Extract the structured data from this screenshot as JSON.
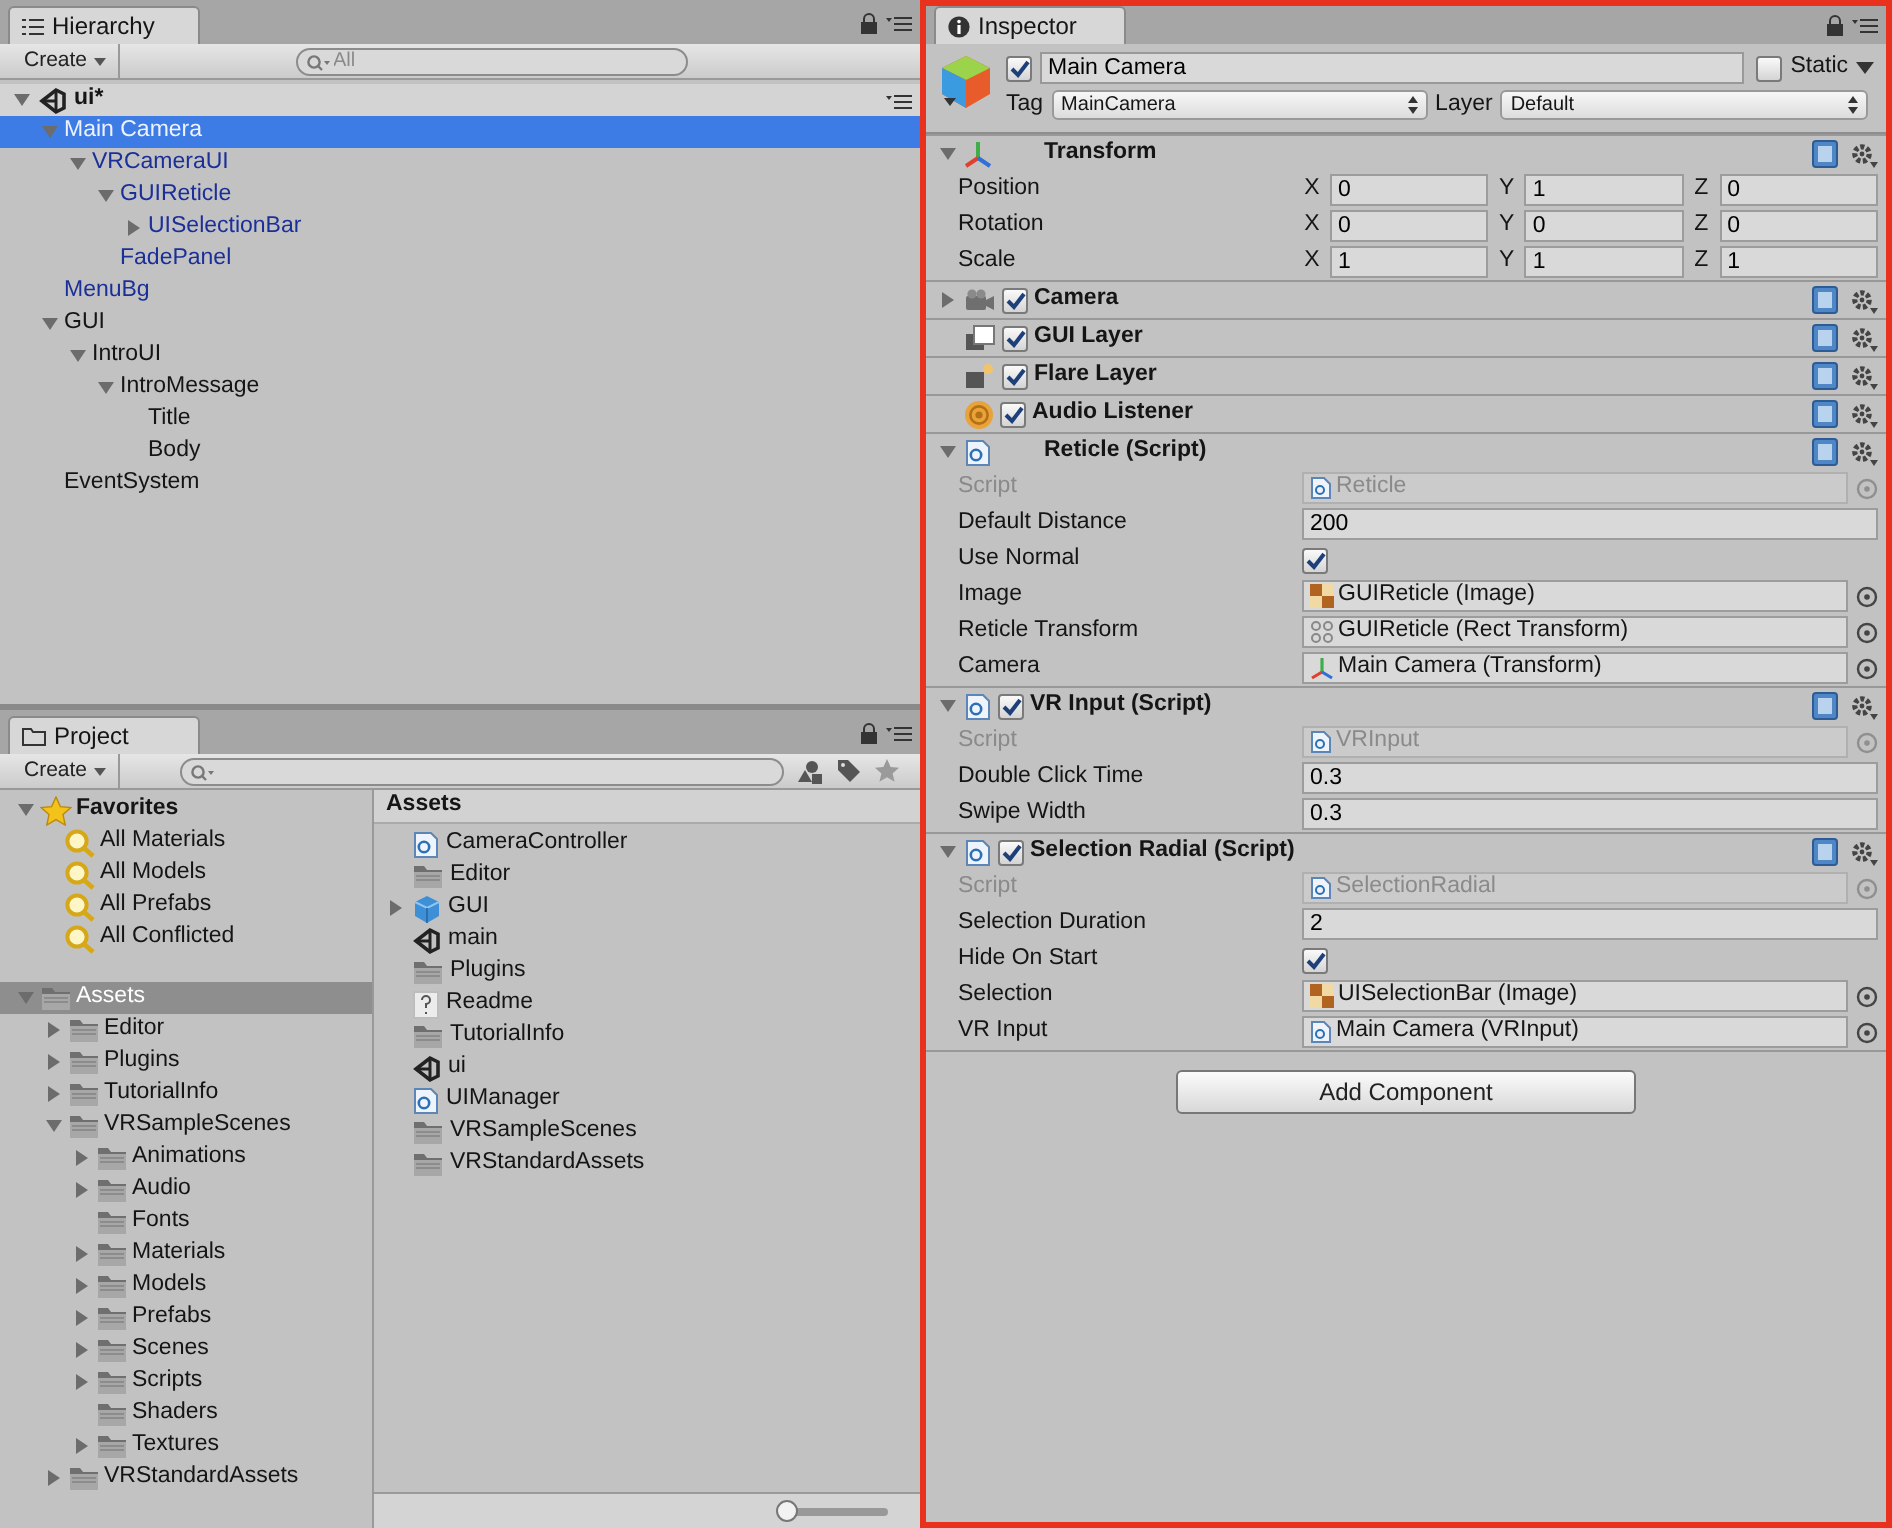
{
  "hierarchy": {
    "tab": "Hierarchy",
    "create": "Create",
    "search_placeholder": "All",
    "scene": {
      "label": "ui*",
      "expanded": true
    },
    "items": [
      {
        "label": "Main Camera",
        "kind": "prefab",
        "selected": true,
        "expanded": true,
        "children": [
          {
            "label": "VRCameraUI",
            "kind": "prefab",
            "selected": false,
            "expanded": true,
            "children": [
              {
                "label": "GUIReticle",
                "kind": "prefab",
                "selected": false,
                "expanded": true,
                "children": [
                  {
                    "label": "UISelectionBar",
                    "kind": "prefab",
                    "selected": false,
                    "expanded": false
                  }
                ]
              },
              {
                "label": "FadePanel",
                "kind": "prefab",
                "selected": false
              }
            ]
          }
        ]
      },
      {
        "label": "MenuBg",
        "kind": "prefab",
        "selected": false
      },
      {
        "label": "GUI",
        "kind": "object",
        "selected": false,
        "expanded": true,
        "children": [
          {
            "label": "IntroUI",
            "kind": "object",
            "selected": false,
            "expanded": true,
            "children": [
              {
                "label": "IntroMessage",
                "kind": "object",
                "selected": false,
                "expanded": true,
                "children": [
                  {
                    "label": "Title",
                    "kind": "object",
                    "selected": false
                  },
                  {
                    "label": "Body",
                    "kind": "object",
                    "selected": false
                  }
                ]
              }
            ]
          }
        ]
      },
      {
        "label": "EventSystem",
        "kind": "object",
        "selected": false
      }
    ]
  },
  "project": {
    "tab": "Project",
    "create": "Create",
    "favorites": {
      "label": "Favorites",
      "expanded": true,
      "items": [
        {
          "label": "All Materials",
          "selected": false
        },
        {
          "label": "All Models",
          "selected": false
        },
        {
          "label": "All Prefabs",
          "selected": false
        },
        {
          "label": "All Conflicted",
          "selected": false
        }
      ]
    },
    "assets_tree": [
      {
        "label": "Assets",
        "selected": true,
        "expanded": true,
        "children": [
          {
            "label": "Editor",
            "selected": false,
            "expanded": false
          },
          {
            "label": "Plugins",
            "selected": false,
            "expanded": false
          },
          {
            "label": "TutorialInfo",
            "selected": false,
            "expanded": false
          },
          {
            "label": "VRSampleScenes",
            "selected": false,
            "expanded": true,
            "children": [
              {
                "label": "Animations",
                "selected": false,
                "expanded": false
              },
              {
                "label": "Audio",
                "selected": false,
                "expanded": false
              },
              {
                "label": "Fonts",
                "selected": false
              },
              {
                "label": "Materials",
                "selected": false,
                "expanded": false
              },
              {
                "label": "Models",
                "selected": false,
                "expanded": false
              },
              {
                "label": "Prefabs",
                "selected": false,
                "expanded": false
              },
              {
                "label": "Scenes",
                "selected": false,
                "expanded": false
              },
              {
                "label": "Scripts",
                "selected": false,
                "expanded": false
              },
              {
                "label": "Shaders",
                "selected": false
              },
              {
                "label": "Textures",
                "selected": false,
                "expanded": false
              }
            ]
          },
          {
            "label": "VRStandardAssets",
            "selected": false,
            "expanded": false
          }
        ]
      }
    ],
    "browser": {
      "header": "Assets",
      "items": [
        {
          "label": "CameraController",
          "kind": "script",
          "selected": false
        },
        {
          "label": "Editor",
          "kind": "folder",
          "selected": false
        },
        {
          "label": "GUI",
          "kind": "prefab",
          "selected": false,
          "expanded": false
        },
        {
          "label": "main",
          "kind": "scene",
          "selected": false
        },
        {
          "label": "Plugins",
          "kind": "folder",
          "selected": false
        },
        {
          "label": "Readme",
          "kind": "text",
          "selected": false
        },
        {
          "label": "TutorialInfo",
          "kind": "folder",
          "selected": false
        },
        {
          "label": "ui",
          "kind": "scene",
          "selected": false
        },
        {
          "label": "UIManager",
          "kind": "script",
          "selected": false
        },
        {
          "label": "VRSampleScenes",
          "kind": "folder",
          "selected": false
        },
        {
          "label": "VRStandardAssets",
          "kind": "folder",
          "selected": false
        }
      ]
    },
    "zoom_slider": {
      "level": 0
    }
  },
  "inspector": {
    "tab": "Inspector",
    "object": {
      "active": true,
      "name": "Main Camera",
      "static_label": "Static",
      "static": false,
      "tag_label": "Tag",
      "tag": "MainCamera",
      "layer_label": "Layer",
      "layer": "Default"
    },
    "components": [
      {
        "kind": "transform",
        "title": "Transform",
        "expanded": true,
        "rows": [
          {
            "label": "Position",
            "axes": [
              {
                "axis": "X",
                "value": "0"
              },
              {
                "axis": "Y",
                "value": "1"
              },
              {
                "axis": "Z",
                "value": "0"
              }
            ]
          },
          {
            "label": "Rotation",
            "axes": [
              {
                "axis": "X",
                "value": "0"
              },
              {
                "axis": "Y",
                "value": "0"
              },
              {
                "axis": "Z",
                "value": "0"
              }
            ]
          },
          {
            "label": "Scale",
            "axes": [
              {
                "axis": "X",
                "value": "1"
              },
              {
                "axis": "Y",
                "value": "1"
              },
              {
                "axis": "Z",
                "value": "1"
              }
            ]
          }
        ]
      },
      {
        "kind": "camera",
        "title": "Camera",
        "expanded": false,
        "enabled": true
      },
      {
        "kind": "gui_layer",
        "title": "GUI Layer",
        "enabled": true
      },
      {
        "kind": "flare_layer",
        "title": "Flare Layer",
        "enabled": true
      },
      {
        "kind": "audio_listener",
        "title": "Audio Listener",
        "enabled": true
      },
      {
        "kind": "script",
        "title": "Reticle (Script)",
        "expanded": true,
        "properties": [
          {
            "kind": "script",
            "label": "Script",
            "value": "Reticle",
            "disabled": true
          },
          {
            "kind": "field",
            "label": "Default Distance",
            "value": "200"
          },
          {
            "kind": "toggle",
            "label": "Use Normal",
            "checked": true
          },
          {
            "kind": "object",
            "label": "Image",
            "ref": {
              "kind": "image",
              "text": "GUIReticle (Image)"
            }
          },
          {
            "kind": "object",
            "label": "Reticle Transform",
            "ref": {
              "kind": "rect_transform",
              "text": "GUIReticle (Rect Transform)"
            }
          },
          {
            "kind": "object",
            "label": "Camera",
            "ref": {
              "kind": "transform",
              "text": "Main Camera (Transform)"
            }
          }
        ]
      },
      {
        "kind": "script",
        "title": "VR Input (Script)",
        "expanded": true,
        "enabled": true,
        "properties": [
          {
            "kind": "script",
            "label": "Script",
            "value": "VRInput",
            "disabled": true
          },
          {
            "kind": "field",
            "label": "Double Click Time",
            "value": "0.3"
          },
          {
            "kind": "field",
            "label": "Swipe Width",
            "value": "0.3"
          }
        ]
      },
      {
        "kind": "script",
        "title": "Selection Radial (Script)",
        "expanded": true,
        "enabled": true,
        "properties": [
          {
            "kind": "script",
            "label": "Script",
            "value": "SelectionRadial",
            "disabled": true
          },
          {
            "kind": "field",
            "label": "Selection Duration",
            "value": "2"
          },
          {
            "kind": "toggle",
            "label": "Hide On Start",
            "checked": true
          },
          {
            "kind": "object",
            "label": "Selection",
            "ref": {
              "kind": "image",
              "text": "UISelectionBar (Image)"
            }
          },
          {
            "kind": "object",
            "label": "VR Input",
            "ref": {
              "kind": "script",
              "text": "Main Camera (VRInput)"
            }
          }
        ]
      }
    ],
    "add_button": "Add Component"
  }
}
